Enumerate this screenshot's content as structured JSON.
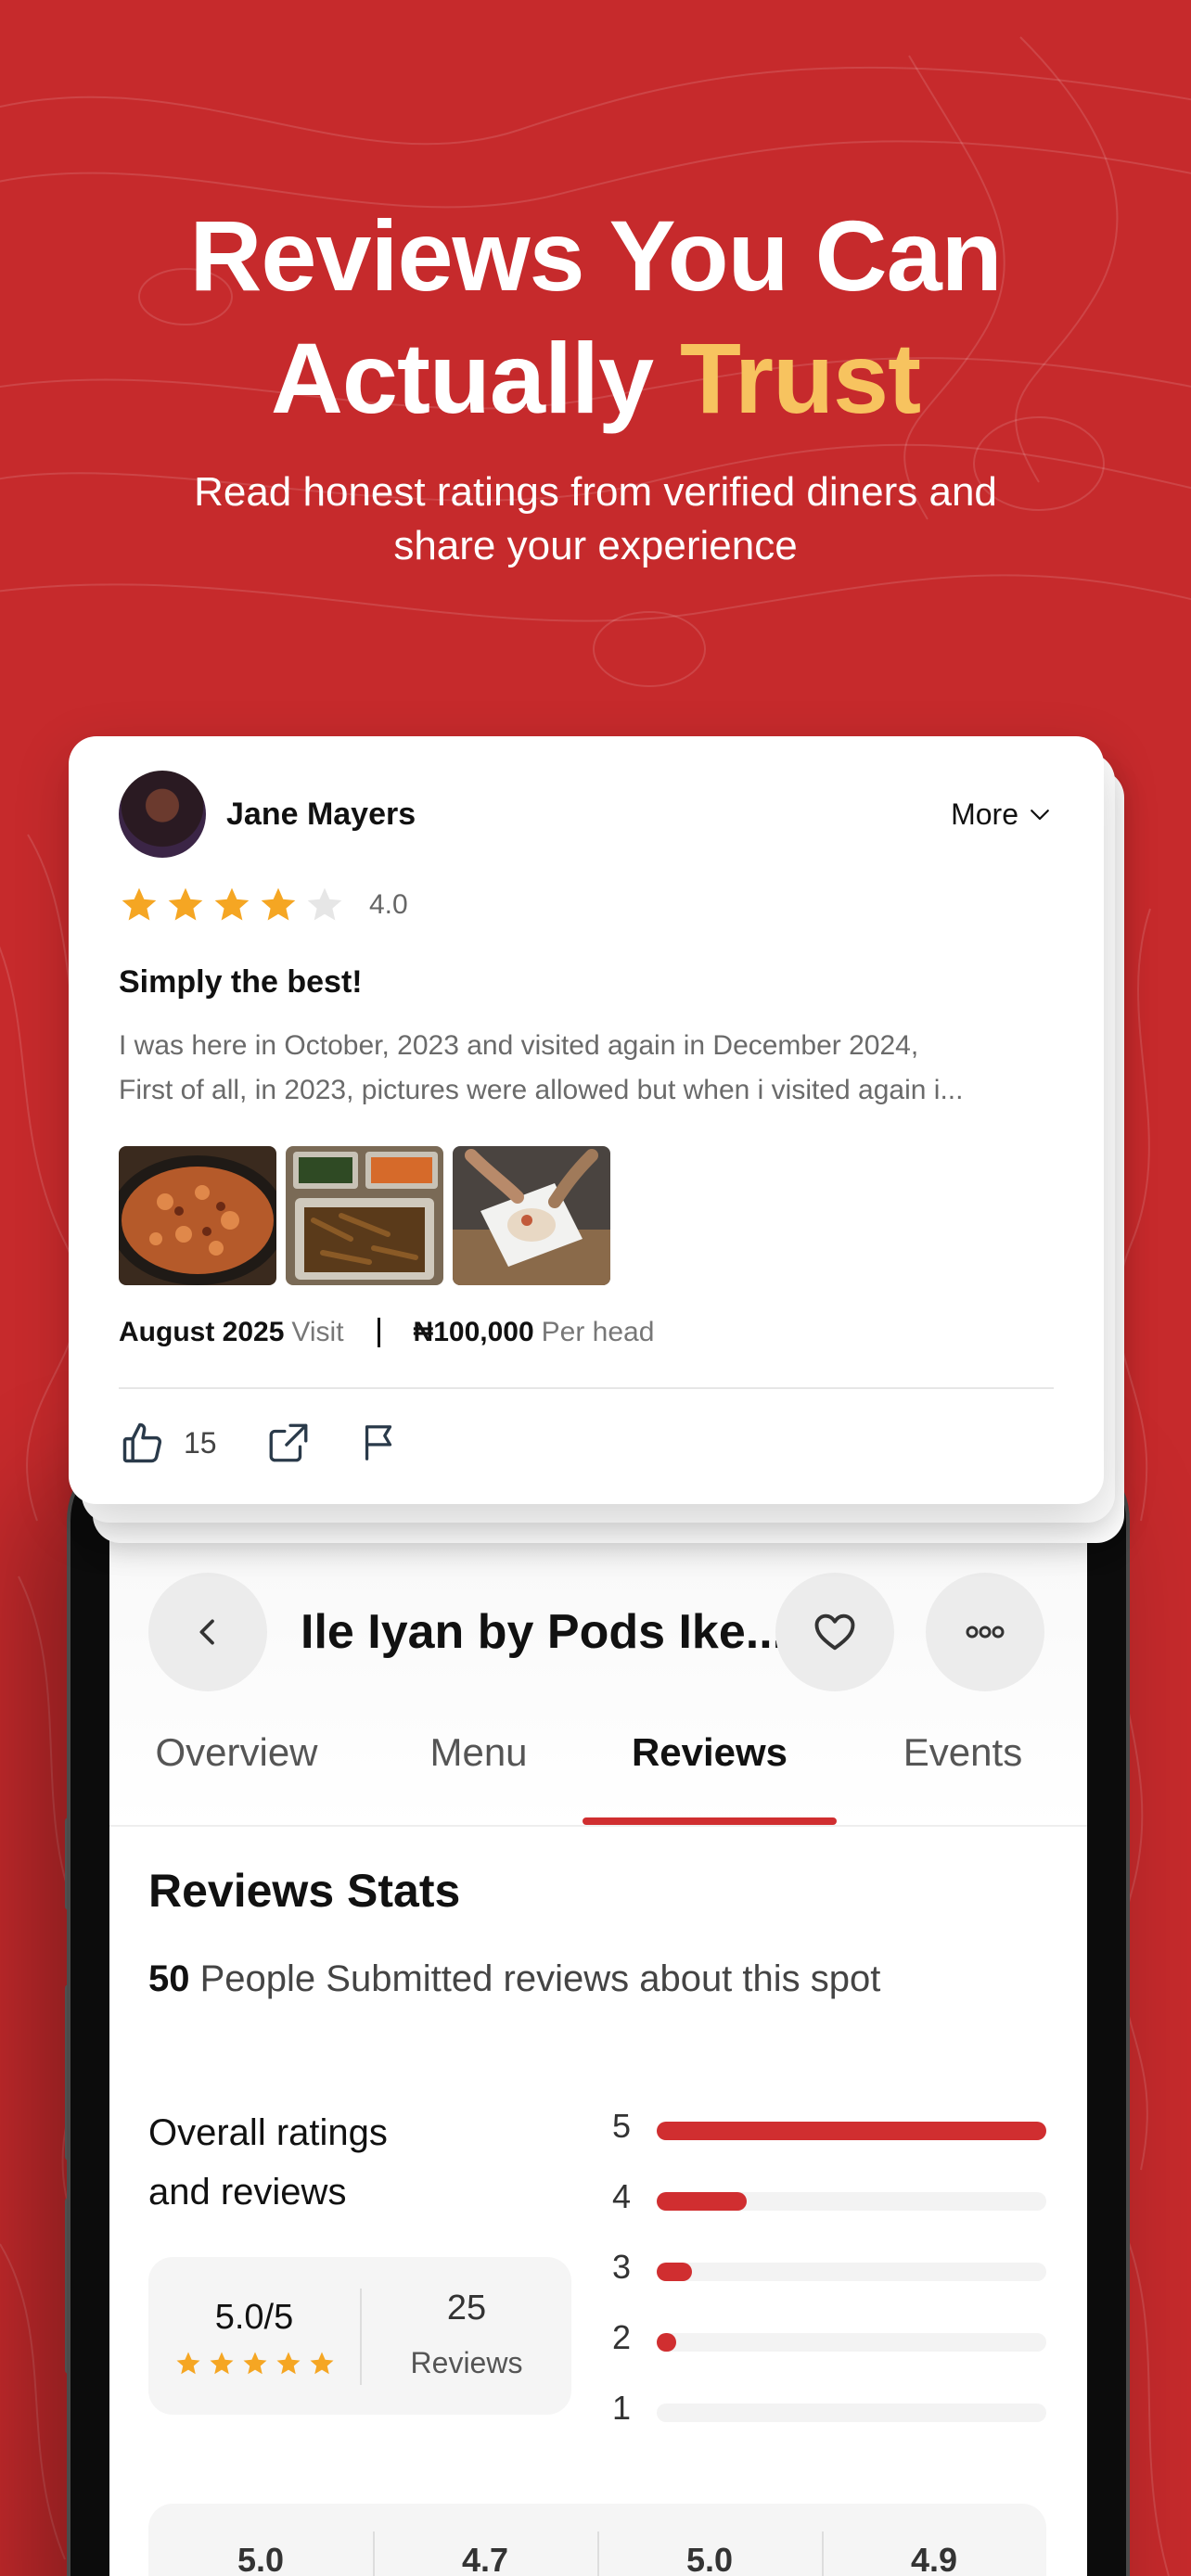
{
  "hero": {
    "title_line1": "Reviews You Can",
    "title_line2_plain": "Actually ",
    "title_line2_accent": "Trust",
    "subtitle_line1": "Read honest ratings from verified diners and",
    "subtitle_line2": "share your experience"
  },
  "review": {
    "author": "Jane Mayers",
    "more_label": "More",
    "rating": "4.0",
    "rating_value": 4,
    "title": "Simply the best!",
    "body_line1": "I was here in October, 2023 and visited again in December 2024,",
    "body_line2": "First of all, in 2023, pictures were allowed but when i visited again i...",
    "visit_date": "August 2025",
    "visit_label": "Visit",
    "price": "₦100,000",
    "price_label": "Per head",
    "likes": "15"
  },
  "app": {
    "place_name": "Ile Iyan by Pods Ike...",
    "tabs": [
      "Overview",
      "Menu",
      "Reviews",
      "Events"
    ],
    "active_tab": "Reviews"
  },
  "stats": {
    "title": "Reviews Stats",
    "count": "50",
    "count_text": "People Submitted reviews about this spot",
    "overall_line1": "Overall ratings",
    "overall_line2": "and reviews",
    "score": "5.0/5",
    "reviews_count": "25",
    "reviews_label": "Reviews",
    "bars": [
      {
        "label": "5",
        "fraction": 1.0
      },
      {
        "label": "4",
        "fraction": 0.23
      },
      {
        "label": "3",
        "fraction": 0.09
      },
      {
        "label": "2",
        "fraction": 0.05
      },
      {
        "label": "1",
        "fraction": 0.0
      }
    ],
    "sub_scores": [
      "5.0",
      "4.7",
      "5.0",
      "4.9"
    ]
  },
  "colors": {
    "brand_red": "#c62a2c",
    "accent_gold": "#f7c35f",
    "star": "#f5a623",
    "bar_red": "#d02e30"
  }
}
